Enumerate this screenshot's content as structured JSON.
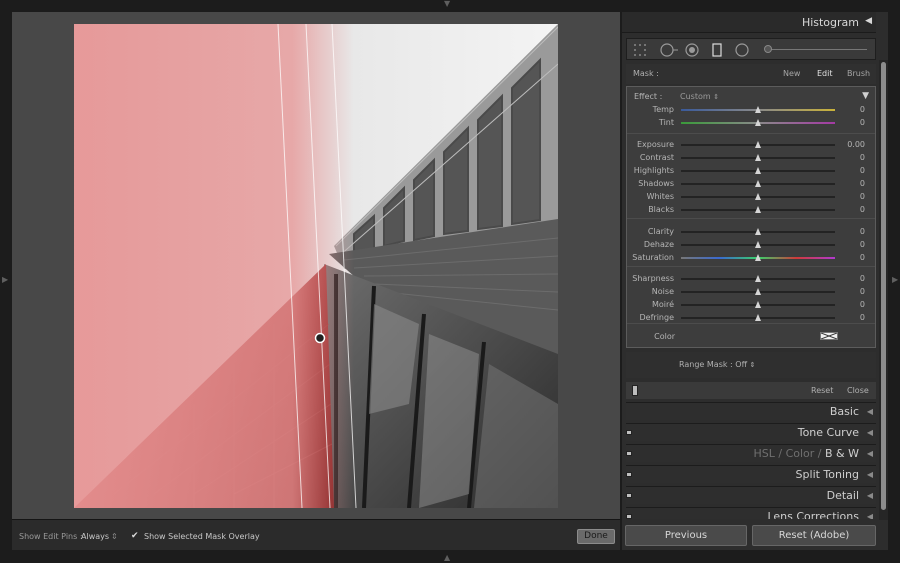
{
  "colors": {
    "mask_overlay": "#e89494",
    "panel_bg": "#2d2d2d",
    "edit_box_bg": "#3d3d3d"
  },
  "panel": {
    "histogram_title": "Histogram",
    "mask": {
      "label": "Mask :",
      "options": [
        "New",
        "Edit",
        "Brush"
      ],
      "active": "Edit"
    },
    "effect": {
      "label": "Effect :",
      "value": "Custom"
    },
    "sliders": [
      {
        "label": "Temp",
        "value": "0",
        "position": 0.5,
        "gradient": "temp"
      },
      {
        "label": "Tint",
        "value": "0",
        "position": 0.5,
        "gradient": "tint"
      },
      {
        "label": "Exposure",
        "value": "0.00",
        "position": 0.5,
        "gradient": "none"
      },
      {
        "label": "Contrast",
        "value": "0",
        "position": 0.5,
        "gradient": "none"
      },
      {
        "label": "Highlights",
        "value": "0",
        "position": 0.5,
        "gradient": "none"
      },
      {
        "label": "Shadows",
        "value": "0",
        "position": 0.5,
        "gradient": "none"
      },
      {
        "label": "Whites",
        "value": "0",
        "position": 0.5,
        "gradient": "none"
      },
      {
        "label": "Blacks",
        "value": "0",
        "position": 0.5,
        "gradient": "none"
      },
      {
        "label": "Clarity",
        "value": "0",
        "position": 0.5,
        "gradient": "none"
      },
      {
        "label": "Dehaze",
        "value": "0",
        "position": 0.5,
        "gradient": "none"
      },
      {
        "label": "Saturation",
        "value": "0",
        "position": 0.5,
        "gradient": "saturation"
      },
      {
        "label": "Sharpness",
        "value": "0",
        "position": 0.5,
        "gradient": "none"
      },
      {
        "label": "Noise",
        "value": "0",
        "position": 0.5,
        "gradient": "none"
      },
      {
        "label": "Moiré",
        "value": "0",
        "position": 0.5,
        "gradient": "none"
      },
      {
        "label": "Defringe",
        "value": "0",
        "position": 0.5,
        "gradient": "none"
      }
    ],
    "color_label": "Color",
    "range_mask": "Range Mask : Off",
    "reset_label": "Reset",
    "close_label": "Close",
    "sections": [
      {
        "name": "Basic",
        "icon": "collapse-triangle-icon"
      },
      {
        "name": "Tone Curve",
        "icon": "collapse-triangle-icon"
      },
      {
        "name": "HSL / Color / B & W",
        "icon": "collapse-triangle-icon"
      },
      {
        "name": "Split Toning",
        "icon": "collapse-triangle-icon"
      },
      {
        "name": "Detail",
        "icon": "collapse-triangle-icon"
      },
      {
        "name": "Lens Corrections",
        "icon": "collapse-triangle-icon"
      }
    ],
    "hsl_parts": [
      "HSL",
      "Color",
      "B & W"
    ],
    "previous_label": "Previous",
    "reset_adobe_label": "Reset (Adobe)"
  },
  "toolbar": {
    "show_pins_label": "Show Edit Pins :",
    "show_pins_value": "Always",
    "overlay_label": "Show Selected Mask Overlay",
    "overlay_checked": true,
    "done_label": "Done"
  }
}
